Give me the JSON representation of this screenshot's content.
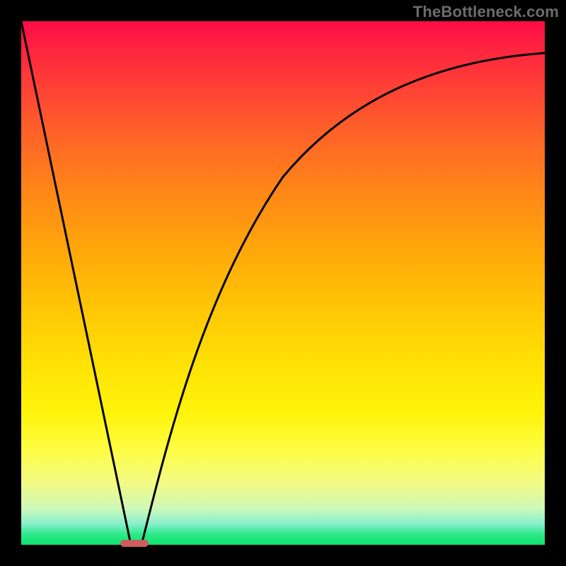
{
  "watermark": "TheBottleneck.com",
  "colors": {
    "frame": "#000000",
    "curve": "#000000",
    "marker": "#cd5c5c",
    "gradient_top": "#ff0b47",
    "gradient_bottom": "#0ee36c"
  },
  "chart_data": {
    "type": "line",
    "title": "",
    "xlabel": "",
    "ylabel": "",
    "xlim": [
      0,
      100
    ],
    "ylim": [
      0,
      100
    ],
    "grid": false,
    "annotations": [
      "TheBottleneck.com"
    ],
    "series": [
      {
        "name": "left-linear-drop",
        "x": [
          0,
          21
        ],
        "values": [
          100,
          0
        ]
      },
      {
        "name": "right-saturating-rise",
        "x": [
          23,
          26,
          30,
          35,
          40,
          45,
          50,
          55,
          60,
          65,
          70,
          75,
          80,
          85,
          90,
          95,
          100
        ],
        "values": [
          0,
          10,
          22,
          35,
          46,
          54,
          61,
          67,
          72,
          76,
          79,
          82,
          84,
          86,
          88,
          89,
          90
        ]
      }
    ],
    "marker": {
      "x_start": 19,
      "x_end": 24,
      "y": 0
    },
    "note": "values read off the image (percent of plot height); right segment is an asymptotic curve approaching ~90%"
  }
}
